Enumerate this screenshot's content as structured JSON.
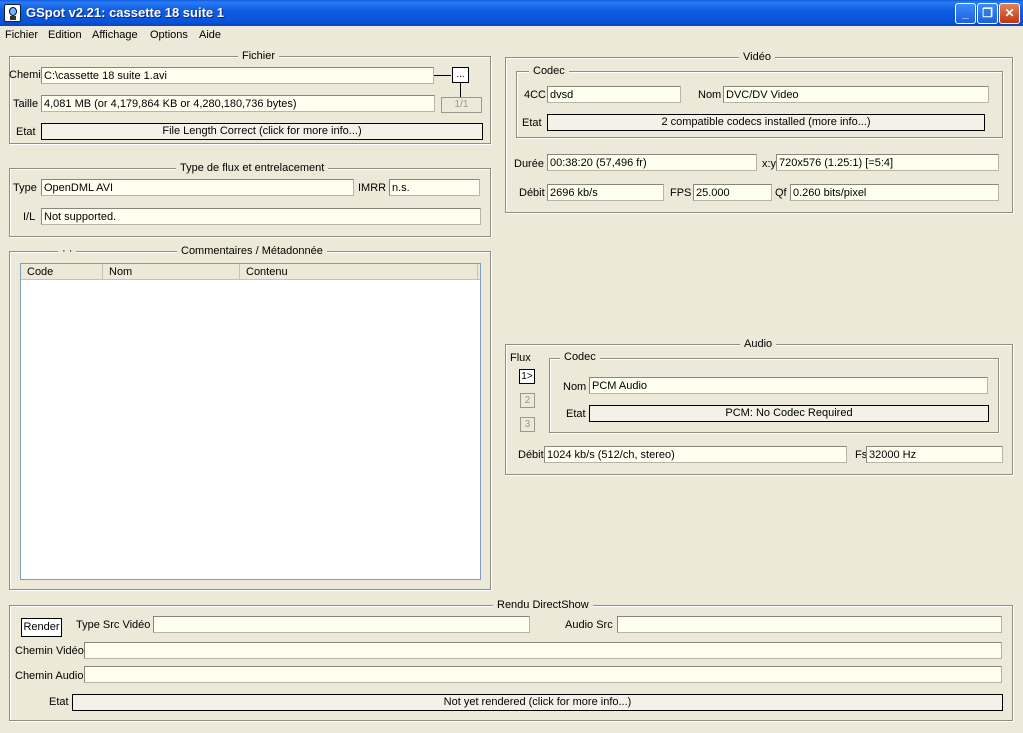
{
  "window": {
    "title": "GSpot v2.21: cassette 18 suite 1"
  },
  "menu": [
    "Fichier",
    "Edition",
    "Affichage",
    "Options",
    "Aide"
  ],
  "fichier": {
    "title": "Fichier",
    "chemin_label": "Chemin",
    "chemin_value": "C:\\cassette 18 suite 1.avi",
    "browse_label": "...",
    "taille_label": "Taille",
    "taille_value": "4,081 MB (or 4,179,864 KB or 4,280,180,736 bytes)",
    "page_label": "1/1",
    "etat_label": "Etat",
    "etat_value": "File Length Correct (click for more info...)"
  },
  "flux": {
    "title": "Type de flux et entrelacement",
    "type_label": "Type",
    "type_value": "OpenDML AVI",
    "imrr_label": "IMRR",
    "imrr_value": "n.s.",
    "il_label": "I/L",
    "il_value": "Not supported."
  },
  "comments": {
    "title_prefix": "· ·",
    "title": "Commentaires / Métadonnée",
    "columns": [
      "Code",
      "Nom",
      "Contenu"
    ]
  },
  "video": {
    "title": "Vidéo",
    "codec_title": "Codec",
    "fourcc_label": "4CC",
    "fourcc_value": "dvsd",
    "nom_label": "Nom",
    "nom_value": "DVC/DV Video",
    "etat_label": "Etat",
    "etat_value": "2 compatible codecs installed (more info...)",
    "duree_label": "Durée",
    "duree_value": "00:38:20 (57,496 fr)",
    "xy_label": "x:y",
    "xy_value": "720x576 (1.25:1) [=5:4]",
    "debit_label": "Débit",
    "debit_value": "2696 kb/s",
    "fps_label": "FPS",
    "fps_value": "25.000",
    "qf_label": "Qf",
    "qf_value": "0.260 bits/pixel"
  },
  "audio": {
    "title": "Audio",
    "flux_label": "Flux",
    "streams": [
      "1>",
      "2",
      "3"
    ],
    "codec_title": "Codec",
    "nom_label": "Nom",
    "nom_value": "PCM Audio",
    "etat_label": "Etat",
    "etat_value": "PCM: No Codec Required",
    "debit_label": "Débit",
    "debit_value": "1024 kb/s (512/ch, stereo)",
    "fs_label": "Fs",
    "fs_value": "32000 Hz"
  },
  "rendu": {
    "title": "Rendu DirectShow",
    "render_button": "Render",
    "type_src_label": "Type Src Vidéo",
    "type_src_value": "",
    "audio_src_label": "Audio Src",
    "audio_src_value": "",
    "chemin_video_label": "Chemin Vidéo",
    "chemin_video_value": "",
    "chemin_audio_label": "Chemin Audio",
    "chemin_audio_value": "",
    "etat_label": "Etat",
    "etat_value": "Not yet rendered (click for more info...)"
  }
}
